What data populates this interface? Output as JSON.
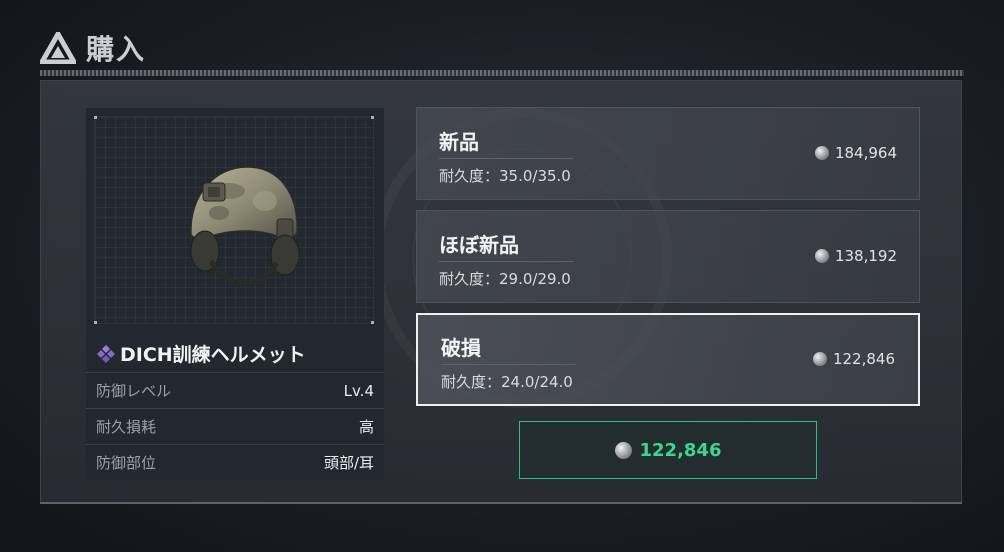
{
  "header": {
    "title": "購入",
    "logo_icon": "triangle-logo-icon"
  },
  "item": {
    "name": "DICH訓練ヘルメット",
    "rarity_icon": "purple-diamond-icon",
    "image_icon": "helmet-icon",
    "stats": [
      {
        "label": "防御レベル",
        "value": "Lv.4"
      },
      {
        "label": "耐久損耗",
        "value": "高"
      },
      {
        "label": "防御部位",
        "value": "頭部/耳"
      }
    ]
  },
  "options": [
    {
      "title": "新品",
      "durability": "耐久度：35.0/35.0",
      "price": "184,964",
      "selected": false
    },
    {
      "title": "ほぼ新品",
      "durability": "耐久度：29.0/29.0",
      "price": "138,192",
      "selected": false
    },
    {
      "title": "破損",
      "durability": "耐久度：24.0/24.0",
      "price": "122,846",
      "selected": true
    }
  ],
  "purchase": {
    "price": "122,846",
    "currency_icon": "coin-icon"
  },
  "colors": {
    "accent_green": "#3dd68c",
    "selected_border": "#eef0f2"
  }
}
